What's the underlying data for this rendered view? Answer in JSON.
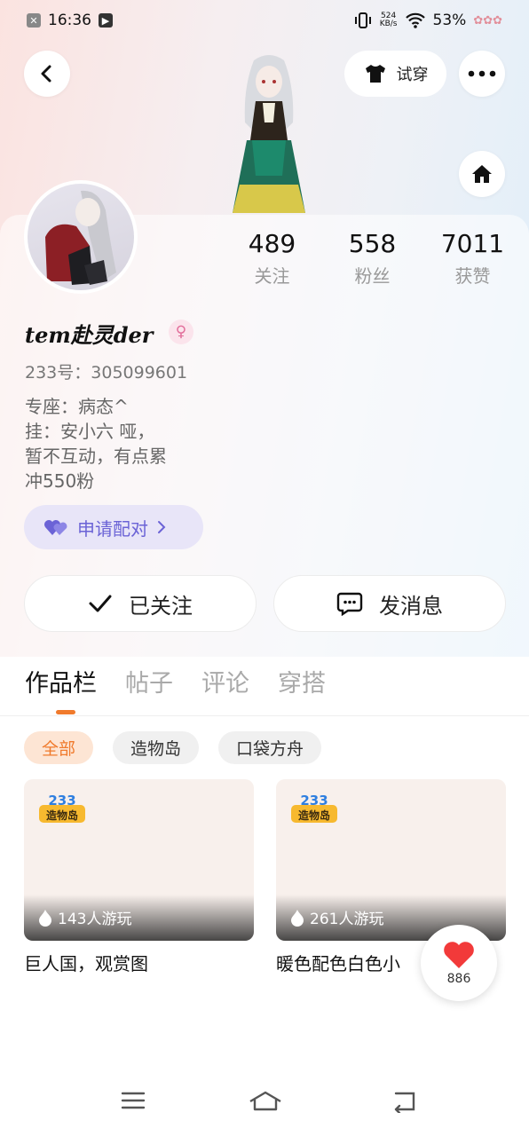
{
  "status_bar": {
    "time": "16:36",
    "net_speed": "524",
    "net_unit": "KB/s",
    "battery": "53%"
  },
  "header": {
    "try_on_label": "试穿"
  },
  "profile": {
    "nickname": "tem赴灵der",
    "gender_symbol": "♀",
    "uid": "233号：305099601",
    "bio_lines": [
      "专座：病态^",
      "挂：安小六 哑，",
      "暂不互动，有点累",
      "冲550粉"
    ],
    "pair_label": "申请配对",
    "stats": [
      {
        "value": "489",
        "label": "关注"
      },
      {
        "value": "558",
        "label": "粉丝"
      },
      {
        "value": "7011",
        "label": "获赞"
      }
    ]
  },
  "actions": {
    "follow_label": "已关注",
    "message_label": "发消息"
  },
  "tabs": [
    "作品栏",
    "帖子",
    "评论",
    "穿搭"
  ],
  "active_tab": "作品栏",
  "chips": [
    "全部",
    "造物岛",
    "口袋方舟"
  ],
  "active_chip": "全部",
  "works": [
    {
      "plays": "143人游玩",
      "title": "巨人国，观赏图",
      "badge_top": "233",
      "badge_bottom": "造物岛"
    },
    {
      "plays": "261人游玩",
      "title": "暖色配色白色小",
      "badge_top": "233",
      "badge_bottom": "造物岛"
    }
  ],
  "like_fab": {
    "count": "886"
  },
  "colors": {
    "accent": "#f07a2c",
    "pair_purple": "#6b63d6",
    "heart_red": "#f23a3a"
  }
}
